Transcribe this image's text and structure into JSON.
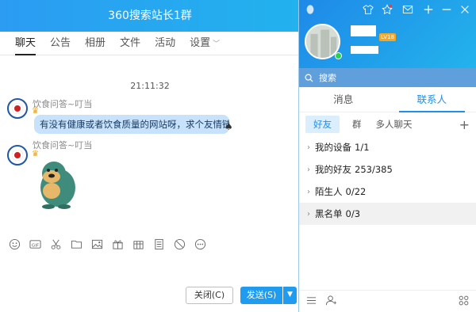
{
  "chat": {
    "title": "360搜索站长1群",
    "tabs": [
      {
        "label": "聊天"
      },
      {
        "label": "公告"
      },
      {
        "label": "相册"
      },
      {
        "label": "文件"
      },
      {
        "label": "活动"
      },
      {
        "label": "设置"
      }
    ],
    "time": "21:11:32",
    "messages": [
      {
        "sender": "饮食问答~叮当",
        "text": "有没有健康或者饮食质量的网站呀，求个友情链接"
      },
      {
        "sender": "饮食问答~叮当",
        "sticker": "cartoon-sticker"
      }
    ],
    "toolbar": [
      "emoji-icon",
      "gif-icon",
      "scissors-icon",
      "folder-icon",
      "image-icon",
      "gift-icon",
      "present-icon",
      "doc-icon",
      "forbid-icon",
      "more-icon"
    ],
    "close_label": "关闭(C)",
    "send_label": "发送(S)"
  },
  "qq": {
    "level_badge": "LV18",
    "search_placeholder": "搜索",
    "tabs": [
      {
        "label": "消息"
      },
      {
        "label": "联系人"
      }
    ],
    "subtabs": [
      {
        "label": "好友"
      },
      {
        "label": "群"
      },
      {
        "label": "多人聊天"
      }
    ],
    "groups": [
      {
        "label": "我的设备",
        "count": "1/1"
      },
      {
        "label": "我的好友",
        "count": "253/385"
      },
      {
        "label": "陌生人",
        "count": "0/22"
      },
      {
        "label": "黑名单",
        "count": "0/3"
      }
    ]
  },
  "colors": {
    "title_bar": "#2b9cf2",
    "accent": "#1e8ff0",
    "bubble": "#c7e2fa",
    "online": "#2ad24a"
  }
}
